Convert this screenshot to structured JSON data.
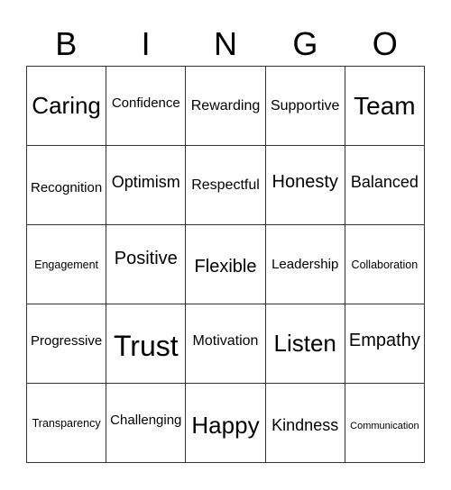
{
  "header": {
    "letters": [
      "B",
      "I",
      "N",
      "G",
      "O"
    ]
  },
  "grid": {
    "rows": [
      [
        "Caring",
        "Confidence",
        "Rewarding",
        "Supportive",
        "Team"
      ],
      [
        "Recognition",
        "Optimism",
        "Respectful",
        "Honesty",
        "Balanced"
      ],
      [
        "Engagement",
        "Positive",
        "Flexible",
        "Leadership",
        "Collaboration"
      ],
      [
        "Progressive",
        "Trust",
        "Motivation",
        "Listen",
        "Empathy"
      ],
      [
        "Transparency",
        "Challenging",
        "Happy",
        "Kindness",
        "Communication"
      ]
    ]
  }
}
